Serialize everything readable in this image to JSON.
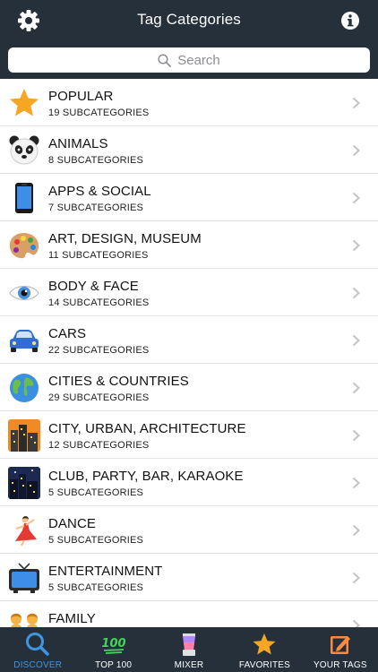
{
  "header": {
    "title": "Tag Categories",
    "settings_icon": "gear-icon",
    "info_icon": "info-icon"
  },
  "search": {
    "placeholder": "Search"
  },
  "categories": [
    {
      "name": "POPULAR",
      "sub": "19 SUBCATEGORIES",
      "icon": "star-icon"
    },
    {
      "name": "ANIMALS",
      "sub": "8 SUBCATEGORIES",
      "icon": "panda-icon"
    },
    {
      "name": "APPS & SOCIAL",
      "sub": "7 SUBCATEGORIES",
      "icon": "phone-icon"
    },
    {
      "name": "ART, DESIGN, MUSEUM",
      "sub": "11 SUBCATEGORIES",
      "icon": "palette-icon"
    },
    {
      "name": "BODY & FACE",
      "sub": "14 SUBCATEGORIES",
      "icon": "eye-icon"
    },
    {
      "name": "CARS",
      "sub": "22 SUBCATEGORIES",
      "icon": "car-icon"
    },
    {
      "name": "CITIES & COUNTRIES",
      "sub": "29 SUBCATEGORIES",
      "icon": "globe-icon"
    },
    {
      "name": "CITY, URBAN, ARCHITECTURE",
      "sub": "12 SUBCATEGORIES",
      "icon": "cityscape-icon"
    },
    {
      "name": "CLUB, PARTY, BAR, KARAOKE",
      "sub": "5 SUBCATEGORIES",
      "icon": "night-city-icon"
    },
    {
      "name": "DANCE",
      "sub": "5 SUBCATEGORIES",
      "icon": "dancer-icon"
    },
    {
      "name": "ENTERTAINMENT",
      "sub": "5 SUBCATEGORIES",
      "icon": "tv-icon"
    },
    {
      "name": "FAMILY",
      "sub": "",
      "icon": "family-icon"
    }
  ],
  "tabs": [
    {
      "label": "DISCOVER",
      "icon": "search-icon",
      "active": true
    },
    {
      "label": "TOP 100",
      "icon": "hundred-icon",
      "active": false
    },
    {
      "label": "MIXER",
      "icon": "blender-icon",
      "active": false
    },
    {
      "label": "FAVORITES",
      "icon": "star-icon",
      "active": false
    },
    {
      "label": "YOUR TAGS",
      "icon": "edit-icon",
      "active": false
    }
  ],
  "colors": {
    "bar": "#26303b",
    "active_tab": "#3f95e0",
    "star": "#f5a623"
  }
}
